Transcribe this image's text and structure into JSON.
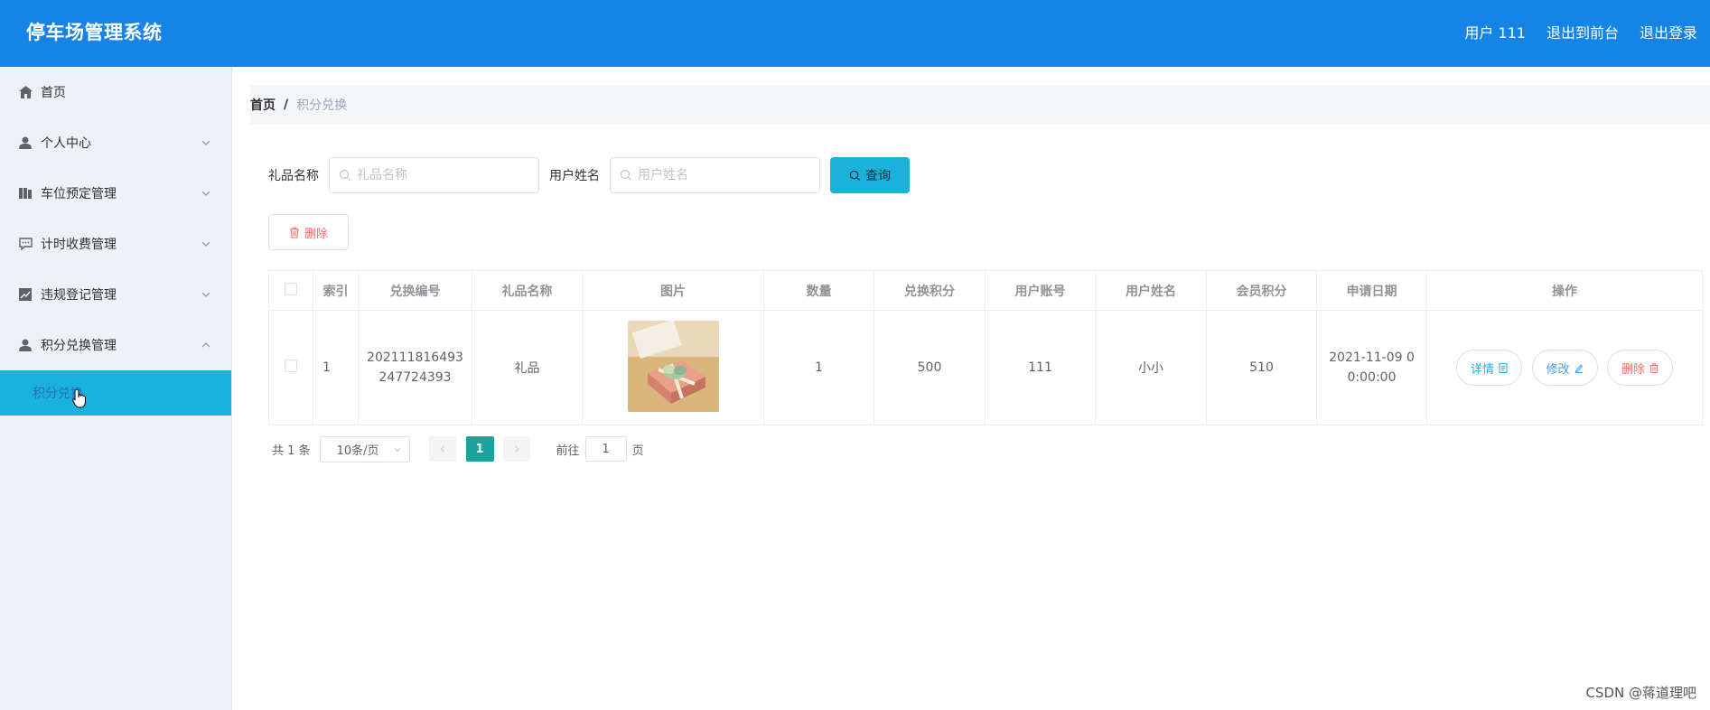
{
  "header": {
    "title": "停车场管理系统",
    "user_label": "用户 111",
    "to_front_label": "退出到前台",
    "logout_label": "退出登录"
  },
  "sidebar": {
    "items": [
      {
        "label": "首页",
        "icon": "home-icon"
      },
      {
        "label": "个人中心",
        "icon": "user-icon"
      },
      {
        "label": "车位预定管理",
        "icon": "parking-icon"
      },
      {
        "label": "计时收费管理",
        "icon": "message-icon"
      },
      {
        "label": "违规登记管理",
        "icon": "chart-icon"
      },
      {
        "label": "积分兑换管理",
        "icon": "user-icon"
      }
    ],
    "sub_active": "积分兑换"
  },
  "breadcrumb": {
    "home": "首页",
    "sep": "/",
    "current": "积分兑换"
  },
  "search": {
    "gift_label": "礼品名称",
    "gift_placeholder": "礼品名称",
    "user_label": "用户姓名",
    "user_placeholder": "用户姓名",
    "query_label": "查询"
  },
  "toolbar": {
    "delete_label": "删除"
  },
  "table": {
    "headers": [
      "索引",
      "兑换编号",
      "礼品名称",
      "图片",
      "数量",
      "兑换积分",
      "用户账号",
      "用户姓名",
      "会员积分",
      "申请日期",
      "操作"
    ],
    "rows": [
      {
        "index": "1",
        "code_line1": "202111816493",
        "code_line2": "247724393",
        "gift": "礼品",
        "qty": "1",
        "points": "500",
        "account": "111",
        "name": "小小",
        "member_points": "510",
        "date_line1": "2021-11-09 0",
        "date_line2": "0:00:00",
        "detail_label": "详情",
        "edit_label": "修改",
        "delete_label": "删除"
      }
    ]
  },
  "pagination": {
    "total": "共 1 条",
    "page_size": "10条/页",
    "current_page": "1",
    "goto_label": "前往",
    "goto_value": "1",
    "page_suffix": "页"
  },
  "watermark": "CSDN @蒋道理吧",
  "colors": {
    "header": "#1684e6",
    "sidebar_bg": "#eef1f6",
    "active_item": "#1ab2da",
    "page_active": "#1aa39a",
    "danger": "#f56c6c"
  }
}
